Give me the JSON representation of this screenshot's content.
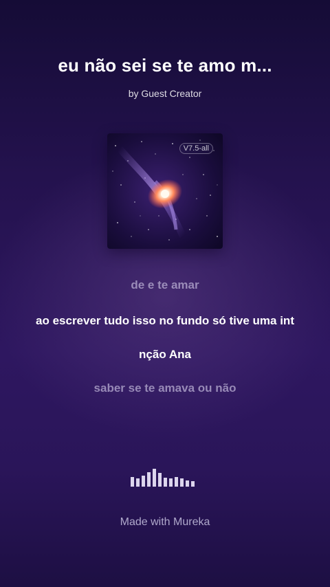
{
  "song": {
    "title": "eu não sei se te amo m...",
    "byline": "by Guest Creator"
  },
  "cover": {
    "version_badge": "V7.5-all"
  },
  "lyrics": [
    {
      "text": "de e te amar",
      "state": "dim"
    },
    {
      "text": "ao escrever tudo isso no fundo só tive uma int",
      "state": "active"
    },
    {
      "text": "nção Ana",
      "state": "active"
    },
    {
      "text": "saber se te amava ou não",
      "state": "dim"
    }
  ],
  "visualizer": {
    "levels": [
      0.55,
      0.45,
      0.6,
      0.8,
      1.0,
      0.75,
      0.5,
      0.45,
      0.55,
      0.45,
      0.35,
      0.3
    ]
  },
  "footer": {
    "text": "Made with Mureka"
  },
  "colors": {
    "background_top": "#150c36",
    "background_mid": "#2e1760",
    "text_primary": "#ffffff",
    "text_dim": "#bdb4d7"
  }
}
